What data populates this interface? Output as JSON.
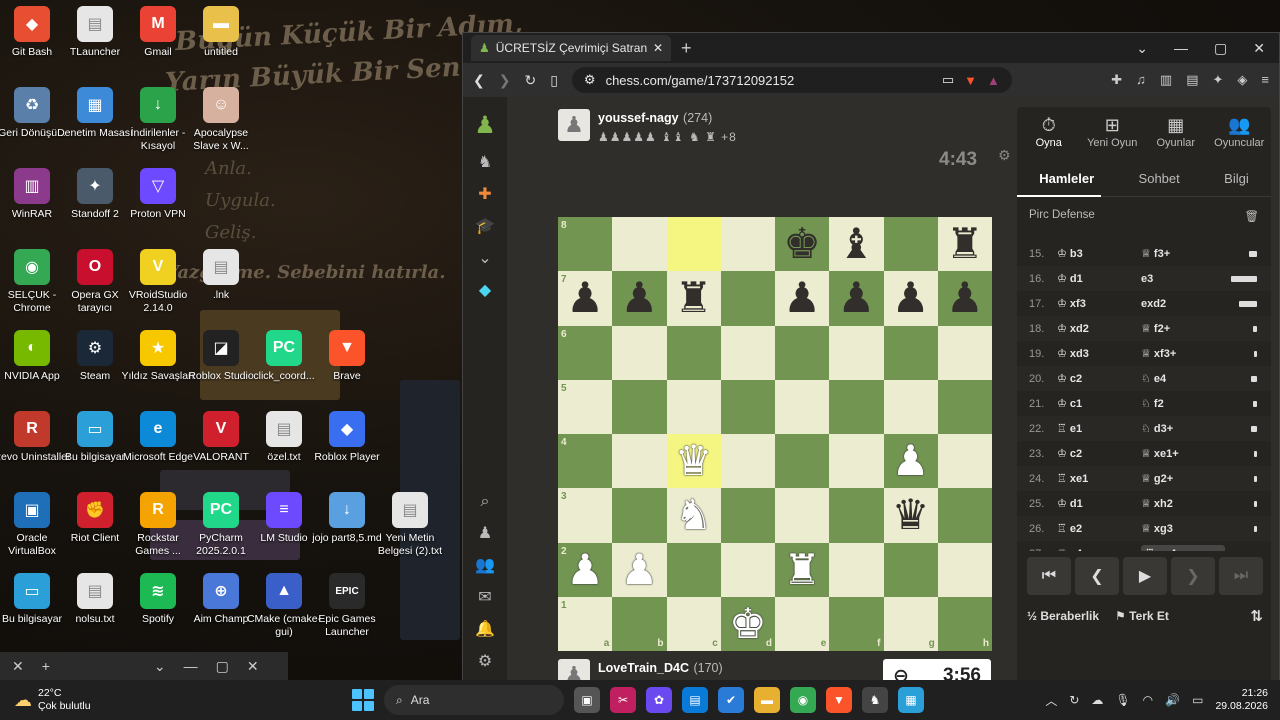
{
  "desktop": {
    "motto_line1": "Bugün Küçük Bir Adım,",
    "motto_line2": "Yarın Büyük Bir Sen.",
    "steps": [
      "Anla.",
      "Uygula.",
      "Geliş."
    ],
    "motto_bottom": "Vazgeçme. Sebebini hatırla.",
    "icons": [
      {
        "label": "Git Bash",
        "color": "#e84e31",
        "glyph": "◆"
      },
      {
        "label": "TLauncher",
        "color": "#e6e6e6",
        "glyph": "▤"
      },
      {
        "label": "Gmail",
        "color": "#ea4335",
        "glyph": "M"
      },
      {
        "label": "untitled",
        "color": "#e8c04a",
        "glyph": "▬"
      },
      {
        "label": "Geri Dönüşü...",
        "color": "#5a7fa8",
        "glyph": "♻"
      },
      {
        "label": "Denetim Masası",
        "color": "#3c8ad8",
        "glyph": "▦"
      },
      {
        "label": "İndirilenler - Kısayol",
        "color": "#2aa34a",
        "glyph": "↓"
      },
      {
        "label": "Apocalypse Slave x W...",
        "color": "#d7b1a0",
        "glyph": "☺"
      },
      {
        "label": "WinRAR",
        "color": "#8c3a8c",
        "glyph": "▥"
      },
      {
        "label": "Standoff 2",
        "color": "#4a5a6a",
        "glyph": "✦"
      },
      {
        "label": "Proton VPN",
        "color": "#6d4aff",
        "glyph": "▽"
      },
      {
        "label": "SELÇUK - Chrome",
        "color": "#34a853",
        "glyph": "◉"
      },
      {
        "label": "Opera GX tarayıcı",
        "color": "#c8102e",
        "glyph": "O"
      },
      {
        "label": "VRoidStudio 2.14.0",
        "color": "#f0d020",
        "glyph": "V"
      },
      {
        "label": ".lnk",
        "color": "#e6e6e6",
        "glyph": "▤"
      },
      {
        "label": "NVIDIA App",
        "color": "#76b900",
        "glyph": "◐"
      },
      {
        "label": "Steam",
        "color": "#1b2838",
        "glyph": "⚙"
      },
      {
        "label": "Yıldız Savaşları",
        "color": "#f7c800",
        "glyph": "★"
      },
      {
        "label": "Roblox Studio",
        "color": "#222",
        "glyph": "◪"
      },
      {
        "label": "click_coord...",
        "color": "#21d789",
        "glyph": "PC"
      },
      {
        "label": "Brave",
        "color": "#fb542b",
        "glyph": "▼"
      },
      {
        "label": "Revo Uninstaller",
        "color": "#c0392b",
        "glyph": "R"
      },
      {
        "label": "Bu bilgisayar",
        "color": "#2a9fd8",
        "glyph": "▭"
      },
      {
        "label": "Microsoft Edge",
        "color": "#0c8ad8",
        "glyph": "e"
      },
      {
        "label": "VALORANT",
        "color": "#d0202e",
        "glyph": "V"
      },
      {
        "label": "özel.txt",
        "color": "#e6e6e6",
        "glyph": "▤"
      },
      {
        "label": "Roblox Player",
        "color": "#3a6ef0",
        "glyph": "◆"
      },
      {
        "label": "Oracle VirtualBox",
        "color": "#1f6fb8",
        "glyph": "▣"
      },
      {
        "label": "Riot Client",
        "color": "#d0202e",
        "glyph": "✊"
      },
      {
        "label": "Rockstar Games ...",
        "color": "#f4a300",
        "glyph": "R"
      },
      {
        "label": "PyCharm 2025.2.0.1",
        "color": "#21d789",
        "glyph": "PC"
      },
      {
        "label": "LM Studio",
        "color": "#6d4aff",
        "glyph": "≡"
      },
      {
        "label": "jojo part8,5.md",
        "color": "#5aa0e0",
        "glyph": "↓"
      },
      {
        "label": "Yeni Metin Belgesi (2).txt",
        "color": "#e6e6e6",
        "glyph": "▤"
      },
      {
        "label": "Bu bilgisayar",
        "color": "#2a9fd8",
        "glyph": "▭"
      },
      {
        "label": "nolsu.txt",
        "color": "#e6e6e6",
        "glyph": "▤"
      },
      {
        "label": "Spotify",
        "color": "#1db954",
        "glyph": "≋"
      },
      {
        "label": "Aim Champ",
        "color": "#4a78d8",
        "glyph": "⊕"
      },
      {
        "label": "CMake (cmake-gui)",
        "color": "#3a5fc8",
        "glyph": "▲"
      },
      {
        "label": "Epic Games Launcher",
        "color": "#2a2a2a",
        "glyph": "EPIC"
      }
    ]
  },
  "browser": {
    "tab_title": "ÜCRETSİZ Çevrimiçi Satranç Oyna",
    "url": "chess.com/game/173712092152"
  },
  "game": {
    "top_player": {
      "name": "youssef-nagy",
      "rating": "(274)",
      "captures": "♟♟♟♟♟ ♝♝ ♞ ♜ +8",
      "clock": "4:43"
    },
    "bottom_player": {
      "name": "LoveTrain_D4C",
      "rating": "(170)",
      "captures": "♙♗♗",
      "clock": "3:56"
    },
    "board": {
      "highlight": [
        "c8",
        "c4"
      ],
      "pieces": [
        {
          "sq": "e8",
          "p": "k"
        },
        {
          "sq": "f8",
          "p": "b"
        },
        {
          "sq": "h8",
          "p": "r"
        },
        {
          "sq": "a7",
          "p": "p"
        },
        {
          "sq": "b7",
          "p": "p"
        },
        {
          "sq": "c7",
          "p": "r"
        },
        {
          "sq": "e7",
          "p": "p"
        },
        {
          "sq": "f7",
          "p": "p"
        },
        {
          "sq": "g7",
          "p": "p"
        },
        {
          "sq": "h7",
          "p": "p"
        },
        {
          "sq": "c4",
          "p": "Q"
        },
        {
          "sq": "g4",
          "p": "P"
        },
        {
          "sq": "c3",
          "p": "N"
        },
        {
          "sq": "g3",
          "p": "q"
        },
        {
          "sq": "a2",
          "p": "P"
        },
        {
          "sq": "b2",
          "p": "P"
        },
        {
          "sq": "e2",
          "p": "R"
        },
        {
          "sq": "d1",
          "p": "K"
        }
      ]
    }
  },
  "panel": {
    "tabs": [
      {
        "label": "Oyna",
        "icon": "⏱"
      },
      {
        "label": "Yeni Oyun",
        "icon": "⊞"
      },
      {
        "label": "Oyunlar",
        "icon": "▦"
      },
      {
        "label": "Oyuncular",
        "icon": "👥"
      }
    ],
    "subtabs": [
      "Hamleler",
      "Sohbet",
      "Bilgi"
    ],
    "opening": "Pirc Defense",
    "moves": [
      {
        "n": "15.",
        "w": "♔ b3",
        "b": "♕ f3+",
        "bar": 8
      },
      {
        "n": "16.",
        "w": "♔ d1",
        "b": "e3",
        "bar": 26
      },
      {
        "n": "17.",
        "w": "♔ xf3",
        "b": "exd2",
        "bar": 18
      },
      {
        "n": "18.",
        "w": "♔ xd2",
        "b": "♕ f2+",
        "bar": 4
      },
      {
        "n": "19.",
        "w": "♔ xd3",
        "b": "♕ xf3+",
        "bar": 3
      },
      {
        "n": "20.",
        "w": "♔ c2",
        "b": "♘ e4",
        "bar": 6
      },
      {
        "n": "21.",
        "w": "♔ c1",
        "b": "♘ f2",
        "bar": 4
      },
      {
        "n": "22.",
        "w": "♖ e1",
        "b": "♘ d3+",
        "bar": 6
      },
      {
        "n": "23.",
        "w": "♔ c2",
        "b": "♕ xe1+",
        "bar": 3
      },
      {
        "n": "24.",
        "w": "♖ xe1",
        "b": "♕ g2+",
        "bar": 3
      },
      {
        "n": "25.",
        "w": "♔ d1",
        "b": "♕ xh2",
        "bar": 3
      },
      {
        "n": "26.",
        "w": "♖ e2",
        "b": "♕ xg3",
        "bar": 3
      },
      {
        "n": "27.",
        "w": "♕ c4",
        "b": "♖ xc4",
        "bar": 3
      }
    ],
    "draw_label": "Beraberlik",
    "resign_label": "Terk Et"
  },
  "taskbar": {
    "temp": "22°C",
    "weather": "Çok bulutlu",
    "search_placeholder": "Ara",
    "time": "21:26",
    "date": "29.08.2026"
  }
}
